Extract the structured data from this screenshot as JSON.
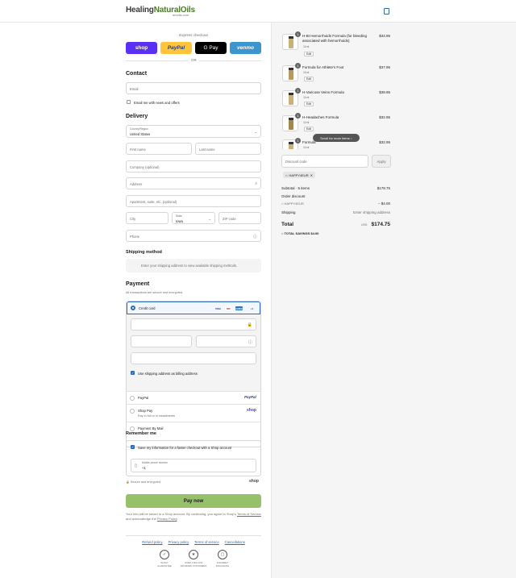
{
  "header": {
    "logo_main_healing": "Healing",
    "logo_main_natural": "NaturalOils",
    "logo_sub": "amolis.com"
  },
  "express": {
    "label": "Express checkout",
    "shop": "shop",
    "paypal": "PayPal",
    "gpay": "G Pay",
    "venmo": "venmo",
    "or": "OR"
  },
  "contact": {
    "title": "Contact",
    "email_placeholder": "Email",
    "news_label": "Email me with news and offers"
  },
  "delivery": {
    "title": "Delivery",
    "country_label": "Country/Region",
    "country_value": "United States",
    "first_name": "First name",
    "last_name": "Last name",
    "company": "Company (optional)",
    "address": "Address",
    "apartment": "Apartment, suite, etc. (optional)",
    "city": "City",
    "state_label": "State",
    "state_value": "Iowa",
    "zip": "ZIP code",
    "phone": "Phone"
  },
  "shipping": {
    "title": "Shipping method",
    "note": "Enter your shipping address to view available shipping methods."
  },
  "payment": {
    "title": "Payment",
    "subtitle": "All transactions are secure and encrypted.",
    "credit_card": "Credit card",
    "card_badges": [
      "VISA",
      "MC",
      "AMEX",
      "+3"
    ],
    "billing_label": "Use shipping address as billing address",
    "paypal": "PayPal",
    "paypal_logo": "PayPal",
    "shop_pay": "Shop Pay",
    "shop_pay_sub": "Pay in full or in installments",
    "shop_logo": "shop",
    "by_mail": "Payment By Mail"
  },
  "remember": {
    "title": "Remember me",
    "save_label": "Save my information for a faster checkout with a Shop account",
    "mobile_label": "Mobile phone number",
    "mobile_value": "+1",
    "secure": "Secure and encrypted",
    "shop_logo": "shop"
  },
  "pay_now": "Pay now",
  "legal": {
    "text1": "Your info will be saved to a Shop account. By continuing, you agree to Shop's",
    "terms": "Terms of Service",
    "and_ack": "and acknowledge the",
    "privacy": "Privacy Policy",
    "dot": "."
  },
  "footer_links": [
    "Refund policy",
    "Privacy policy",
    "Terms of service",
    "Cancellations"
  ],
  "badges": [
    {
      "line1": "90-DAY",
      "line2": "GUARANTEE"
    },
    {
      "line1": "OVER 1 MILLION",
      "line2": "SATISFIED CUSTOMERS"
    },
    {
      "line1": "DISCREET",
      "line2": "PACKAGING"
    }
  ],
  "cart": {
    "items": [
      {
        "name": "H-BI Hemorrhoids Formula (for bleeding associated with hemorrhoids)",
        "size": "11ml",
        "qty": "1",
        "price": "$34.95",
        "edit": "Edit"
      },
      {
        "name": "Formula for Athlete's Foot",
        "size": "11ml",
        "qty": "1",
        "price": "$37.95",
        "edit": "Edit"
      },
      {
        "name": "H-Varicose Veins Formula",
        "size": "11ml",
        "qty": "1",
        "price": "$39.95",
        "edit": "Edit"
      },
      {
        "name": "H-Headaches Formula",
        "size": "11ml",
        "qty": "1",
        "price": "$32.95",
        "edit": "Edit"
      },
      {
        "name": "Formula",
        "size": "11ml",
        "qty": "1",
        "price": "$32.95",
        "edit": "Edit"
      }
    ],
    "scroll_pill": "Scroll for more items",
    "discount_placeholder": "Discount code",
    "apply": "Apply",
    "tag": "HAPPY4EUR",
    "subtotal_label": "Subtotal · 5 items",
    "subtotal_value": "$178.75",
    "order_discount": "Order discount",
    "discount_code": "HAPPY4EUR",
    "discount_value": "− $4.00",
    "shipping_label": "Shipping",
    "shipping_value": "Enter shipping address",
    "total_label": "Total",
    "currency": "USD",
    "total_value": "$174.75",
    "savings_label": "TOTAL SAVINGS",
    "savings_value": "$4.00"
  }
}
